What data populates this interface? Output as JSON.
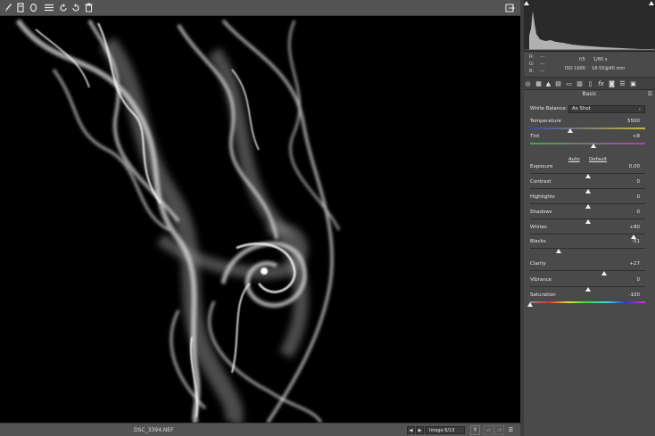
{
  "toolbar": {
    "icons": [
      "brush-icon",
      "crop-icon",
      "ellipse-icon",
      "list-icon",
      "rotate-left-icon",
      "rotate-right-icon",
      "trash-icon",
      "export-icon"
    ]
  },
  "status": {
    "filename": "DSC_3394.NEF",
    "image_counter": "Image 6/13"
  },
  "info": {
    "r_label": "R:",
    "g_label": "G:",
    "b_label": "B:",
    "r_value": "---",
    "g_value": "---",
    "b_value": "---",
    "aperture": "f/5",
    "shutter": "1/60 s",
    "iso": "ISO 1000",
    "lens": "18-55@40 mm"
  },
  "panel": {
    "section_title": "Basic",
    "white_balance_label": "White Balance:",
    "white_balance_value": "As Shot",
    "auto_label": "Auto",
    "default_label": "Default"
  },
  "sliders": [
    {
      "label": "Temperature",
      "value": "5500",
      "level": 0.35
    },
    {
      "label": "Tint",
      "value": "+8",
      "level": 0.55
    },
    {
      "label": "Exposure",
      "value": "0,00",
      "level": 0.5
    },
    {
      "label": "Contrast",
      "value": "0",
      "level": 0.5
    },
    {
      "label": "Highlights",
      "value": "0",
      "level": 0.5
    },
    {
      "label": "Shadows",
      "value": "0",
      "level": 0.5
    },
    {
      "label": "Whites",
      "value": "+80",
      "level": 0.9
    },
    {
      "label": "Blacks",
      "value": "-51",
      "level": 0.25
    },
    {
      "label": "Clarity",
      "value": "+27",
      "level": 0.64
    },
    {
      "label": "Vibrance",
      "value": "0",
      "level": 0.5
    },
    {
      "label": "Saturation",
      "value": "-100",
      "level": 0.0
    }
  ],
  "colors": {
    "panel_bg": "#4a4a4a",
    "canvas_bg": "#000000",
    "temperature_gradient": [
      "#3a4aa8",
      "#c8b83a"
    ],
    "tint_gradient": [
      "#3fae3f",
      "#b03fb0"
    ]
  }
}
